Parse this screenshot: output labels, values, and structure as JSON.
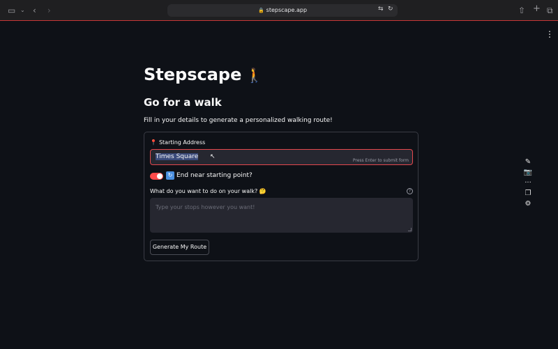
{
  "browser": {
    "url": "stepscape.app",
    "icons": [
      "sidebar-icon",
      "chevron-down-icon",
      "back-icon",
      "forward-icon",
      "lock-icon",
      "translate-icon",
      "reload-icon",
      "share-icon",
      "new-tab-icon",
      "tabs-icon"
    ]
  },
  "app": {
    "title": "Stepscape",
    "title_emoji": "🚶",
    "subtitle": "Go for a walk",
    "description": "Fill in your details to generate a personalized walking route!"
  },
  "form": {
    "address_label": "Starting Address",
    "address_value": "Times Square",
    "address_hint": "Press Enter to submit form",
    "toggle_label": "End near starting point?",
    "toggle_on": true,
    "stops_label": "What do you want to do on your walk? 🤔",
    "stops_placeholder": "Type your stops however you want!",
    "submit_label": "Generate My Route"
  },
  "colors": {
    "accent": "#ff4b4b",
    "background": "#0e1117",
    "input_bg": "#262730"
  }
}
